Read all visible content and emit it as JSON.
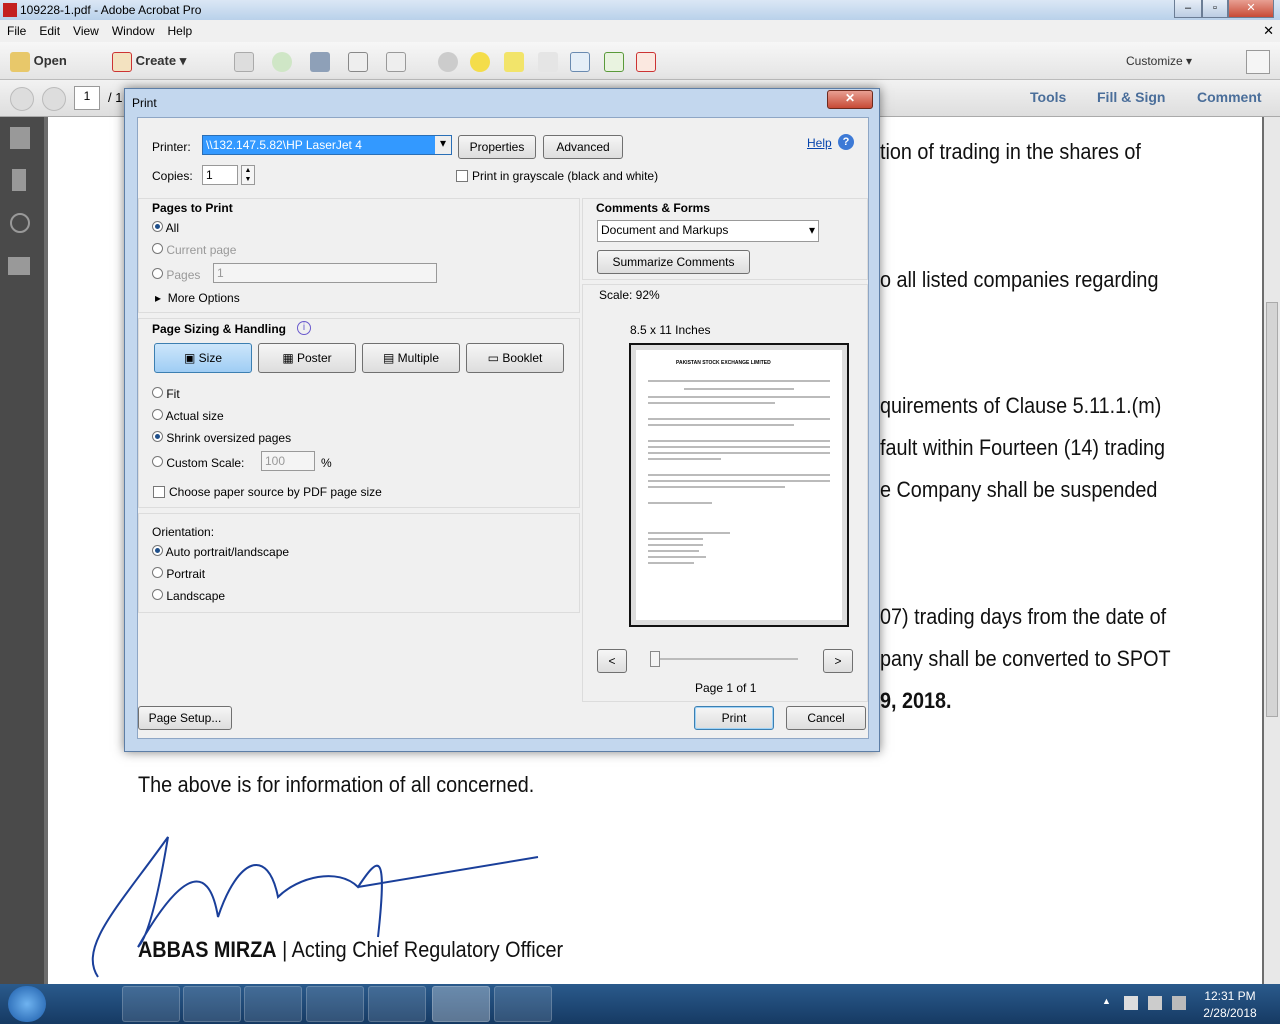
{
  "window": {
    "title": "109228-1.pdf - Adobe Acrobat Pro",
    "minimize": "–",
    "maximize": "▫",
    "close": "✕"
  },
  "menu": [
    "File",
    "Edit",
    "View",
    "Window",
    "Help"
  ],
  "toolbar": {
    "open": "Open",
    "create": "Create",
    "customize": "Customize"
  },
  "nav": {
    "page": "1",
    "total": "/ 1",
    "tools": "Tools",
    "fill_sign": "Fill & Sign",
    "comment": "Comment"
  },
  "document": {
    "lines": [
      "tion of trading in the shares of",
      "o all listed companies regarding",
      "quirements of Clause 5.11.1.(m)",
      "fault within Fourteen (14) trading",
      "e Company  shall be suspended",
      "07) trading days from the date of",
      "pany shall be converted to SPOT",
      "9, 2018."
    ],
    "footer": "The above is for information of all concerned.",
    "signatory_name": "ABBAS MIRZA",
    "signatory_title": "| Acting Chief Regulatory Officer"
  },
  "print": {
    "title": "Print",
    "printer_label": "Printer:",
    "printer_value": "\\\\132.147.5.82\\HP LaserJet 4",
    "properties": "Properties",
    "advanced": "Advanced",
    "help": "Help",
    "copies_label": "Copies:",
    "copies_value": "1",
    "grayscale": "Print in grayscale (black and white)",
    "grayscale_checked": false,
    "pages_to_print": {
      "heading": "Pages to Print",
      "all": "All",
      "current": "Current page",
      "pages": "Pages",
      "pages_value": "1",
      "more": "More Options",
      "selected": "All"
    },
    "sizing": {
      "heading": "Page Sizing & Handling",
      "tabs": [
        "Size",
        "Poster",
        "Multiple",
        "Booklet"
      ],
      "active_tab": "Size",
      "fit": "Fit",
      "actual": "Actual size",
      "shrink": "Shrink oversized pages",
      "custom": "Custom Scale:",
      "custom_value": "100",
      "percent": "%",
      "selected": "Shrink oversized pages",
      "paper_source": "Choose paper source by PDF page size",
      "paper_source_checked": false
    },
    "orientation": {
      "heading": "Orientation:",
      "auto": "Auto portrait/landscape",
      "portrait": "Portrait",
      "landscape": "Landscape",
      "selected": "Auto portrait/landscape"
    },
    "comments": {
      "heading": "Comments & Forms",
      "value": "Document and Markups",
      "summarize": "Summarize Comments"
    },
    "scale": "Scale:  92%",
    "paper": "8.5 x 11 Inches",
    "preview_header": "PAKISTAN STOCK EXCHANGE LIMITED",
    "prev": "<",
    "next": ">",
    "page_of": "Page 1 of 1",
    "page_setup": "Page Setup...",
    "print_btn": "Print",
    "cancel": "Cancel"
  },
  "clock": {
    "time": "12:31 PM",
    "date": "2/28/2018"
  }
}
